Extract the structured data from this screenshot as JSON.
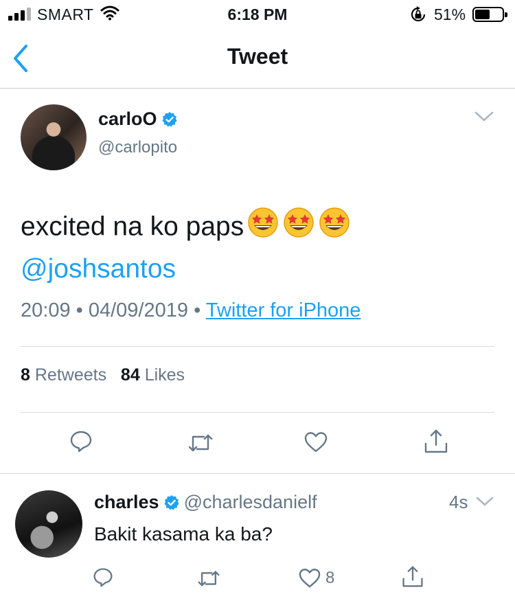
{
  "status_bar": {
    "carrier": "SMART",
    "time": "6:18 PM",
    "battery": "51%"
  },
  "nav": {
    "title": "Tweet",
    "back_icon": "chevron-left-icon"
  },
  "tweet": {
    "display_name": "carloO",
    "handle": "@carlopito",
    "text": "excited na ko paps",
    "emojis": [
      "star-struck",
      "star-struck",
      "star-struck"
    ],
    "mention": "@joshsantos",
    "time": "20:09",
    "date": "04/09/2019",
    "source": "Twitter for iPhone",
    "retweet_count": "8",
    "retweet_label": "Retweets",
    "like_count": "84",
    "like_label": "Likes"
  },
  "reply": {
    "display_name": "charles",
    "handle": "@charlesdanielf",
    "time": "4s",
    "text": "Bakit kasama ka ba?",
    "like_count": "8"
  },
  "colors": {
    "accent": "#1da1f2",
    "muted": "#657786",
    "text": "#14171a"
  }
}
